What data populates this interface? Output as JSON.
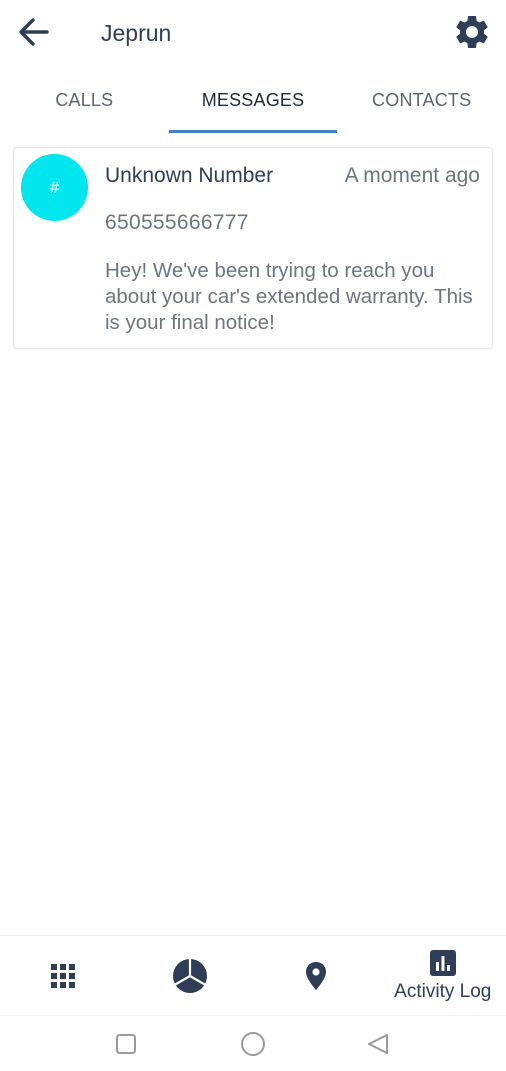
{
  "header": {
    "title": "Jeprun",
    "back_icon": "arrow-left-icon",
    "settings_icon": "gear-icon"
  },
  "tabs": [
    {
      "label": "CALLS",
      "active": false
    },
    {
      "label": "MESSAGES",
      "active": true
    },
    {
      "label": "CONTACTS",
      "active": false
    }
  ],
  "messages": [
    {
      "avatar_text": "#",
      "sender": "Unknown Number",
      "time": "A moment ago",
      "number": "650555666777",
      "body": "Hey! We've been trying to reach you about your car's extended warranty. This is your final notice!"
    }
  ],
  "bottom_nav": [
    {
      "icon": "dialpad-icon",
      "label": ""
    },
    {
      "icon": "pie-chart-icon",
      "label": ""
    },
    {
      "icon": "location-pin-icon",
      "label": ""
    },
    {
      "icon": "bar-chart-icon",
      "label": "Activity Log"
    }
  ],
  "colors": {
    "accent": "#3b82c4",
    "avatar": "#00e5ee",
    "text_primary": "#2f3e56",
    "text_secondary": "#6e7580"
  }
}
